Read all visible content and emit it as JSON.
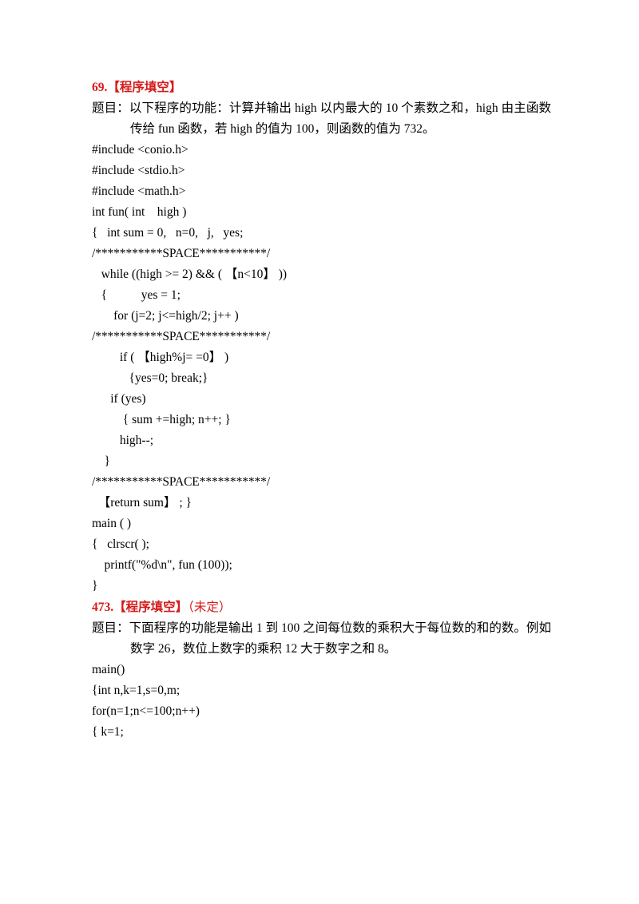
{
  "document": {
    "page_background": "#ffffff",
    "accent_color": "#d61a1a",
    "text_color": "#000000"
  },
  "sections": [
    {
      "id": "problem-69",
      "heading": {
        "number": "69.",
        "tag": "【程序填空】",
        "note": ""
      },
      "statement": {
        "label": "题目：",
        "text": "以下程序的功能：计算并输出 high 以内最大的 10 个素数之和，high 由主函数传给 fun 函数，若 high 的值为 100，则函数的值为 732。"
      },
      "code_lines": [
        "#include <conio.h>",
        "#include <stdio.h>",
        "#include <math.h>",
        "int fun( int    high )",
        "{   int sum = 0,   n=0,   j,   yes;",
        "/***********SPACE***********/",
        "   while ((high >= 2) && ( 【n<10】 ))",
        "   {           yes = 1;",
        "       for (j=2; j<=high/2; j++ )",
        "/***********SPACE***********/",
        "         if ( 【high%j= =0】 )",
        "            {yes=0; break;}",
        "      if (yes)",
        "          { sum +=high; n++; }",
        "         high--;",
        "    }",
        "/***********SPACE***********/",
        "  【return sum】 ; }",
        "main ( )",
        "{   clrscr( );",
        "    printf(\"%d\\n\", fun (100));",
        "}"
      ]
    },
    {
      "id": "problem-473",
      "heading": {
        "number": "473.",
        "tag": "【程序填空】",
        "note": "（未定）"
      },
      "statement": {
        "label": "题目：",
        "text": "下面程序的功能是输出 1 到 100 之间每位数的乘积大于每位数的和的数。例如数字 26，数位上数字的乘积 12 大于数字之和 8。"
      },
      "code_lines": [
        "main()",
        "{int n,k=1,s=0,m;",
        "for(n=1;n<=100;n++)",
        "{ k=1;"
      ]
    }
  ]
}
